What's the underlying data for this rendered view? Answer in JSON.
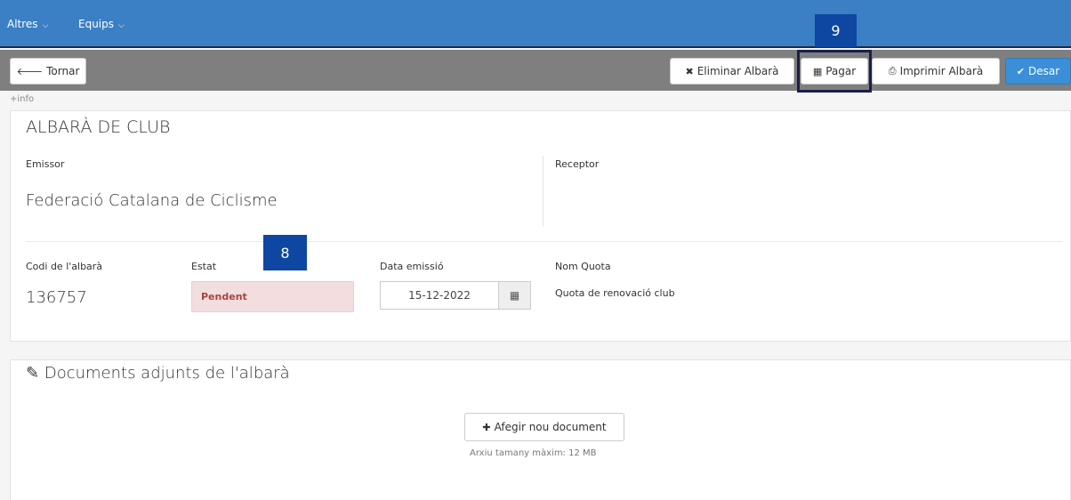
{
  "nav": {
    "items": [
      {
        "label": "Altres"
      },
      {
        "label": "Equips"
      }
    ],
    "chevron": "⌵"
  },
  "toolbar": {
    "back_label": "Tornar",
    "delete_label": "Eliminar Albarà",
    "pay_label": "Pagar",
    "print_label": "Imprimir Albarà",
    "save_label": "Desar"
  },
  "info_link": "+info",
  "invoice": {
    "title": "ALBARÀ DE CLUB",
    "issuer_label": "Emissor",
    "issuer_value": "Federació Catalana de Ciclisme",
    "receiver_label": "Receptor",
    "code_label": "Codi de l'albarà",
    "code_value": "136757",
    "status_label": "Estat",
    "status_value": "Pendent",
    "date_label": "Data emissió",
    "date_value": "15-12-2022",
    "quota_label": "Nom Quota",
    "quota_value": "Quota de renovació club"
  },
  "documents": {
    "title": "Documents adjunts de l'albarà",
    "add_label": "Afegir nou document",
    "max_size_text": "Arxiu tamany màxim: 12 MB"
  },
  "annotations": {
    "badge_8": "8",
    "badge_9": "9"
  },
  "colors": {
    "nav_bg": "#3b7fc4",
    "toolbar_bg": "#7f7f7f",
    "primary": "#3b8fd9",
    "status_bg": "#f2dede",
    "status_text": "#a94442",
    "badge_bg": "#0d47a1"
  }
}
